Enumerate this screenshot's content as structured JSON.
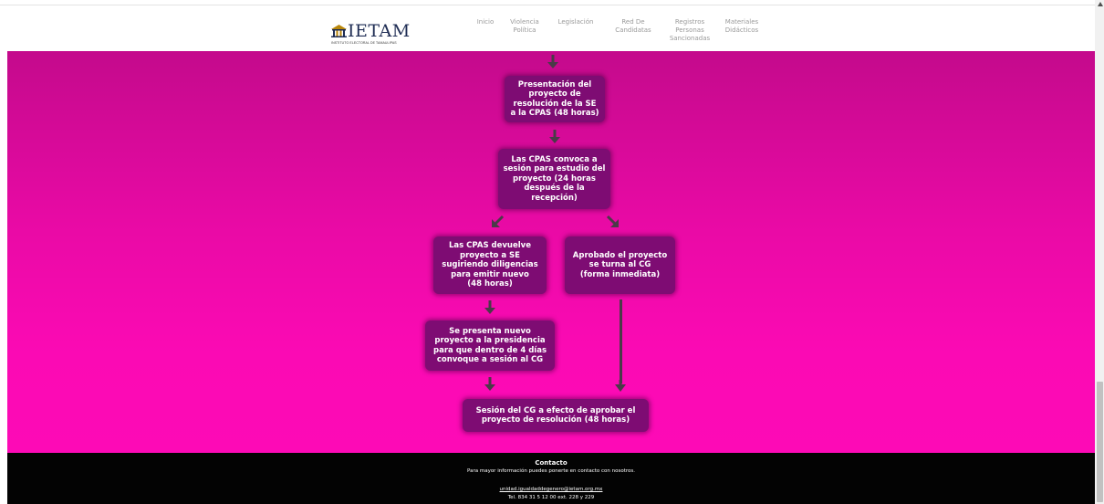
{
  "logo": {
    "name": "IETAM",
    "subtitle": "INSTITUTO ELECTORAL DE TAMAULIPAS"
  },
  "nav": {
    "items": [
      {
        "label": "Inicio"
      },
      {
        "label": "Violencia\nPolítica"
      },
      {
        "label": "Legislación"
      },
      {
        "label": "Red De\nCandidatas"
      },
      {
        "label": "Registros\nPersonas\nSancionadas"
      },
      {
        "label": "Materiales\nDidácticos"
      }
    ]
  },
  "flow": {
    "steps": [
      "Presentación del\nproyecto de\nresolución de la SE\na la CPAS (48 horas)",
      "Las CPAS convoca a\nsesión para estudio del\nproyecto (24 horas\ndespués de la\nrecepción)",
      "Las CPAS devuelve\nproyecto a SE\nsugiriendo diligencias\npara emitir nuevo\n(48 horas)",
      "Aprobado el proyecto\nse turna al CG\n(forma inmediata)",
      "Se presenta nuevo\nproyecto a la presidencia\npara que dentro de 4 días\nconvoque a sesión al CG",
      "Sesión del CG a efecto de aprobar el\nproyecto de resolución (48 horas)"
    ]
  },
  "footer": {
    "title": "Contacto",
    "text": "Para mayor información puedes ponerte en contacto con nosotros.",
    "email": "unidad.igualdaddegenero@ietam.org.mx",
    "phone": "Tel. 834 31 5 12 00 ext. 228 y 229"
  },
  "colors": {
    "gradient_top": "#c40a8c",
    "gradient_bottom": "#fd0ab6",
    "box": "#7e0c73",
    "arrow": "#4a3a48",
    "logo_text": "#1f2d54",
    "footer_bg": "#030303"
  },
  "icons": {
    "logo": "ietam-building-icon",
    "arrow": "arrow-down-icon",
    "scroll": "scroll-up-arrow-icon"
  }
}
